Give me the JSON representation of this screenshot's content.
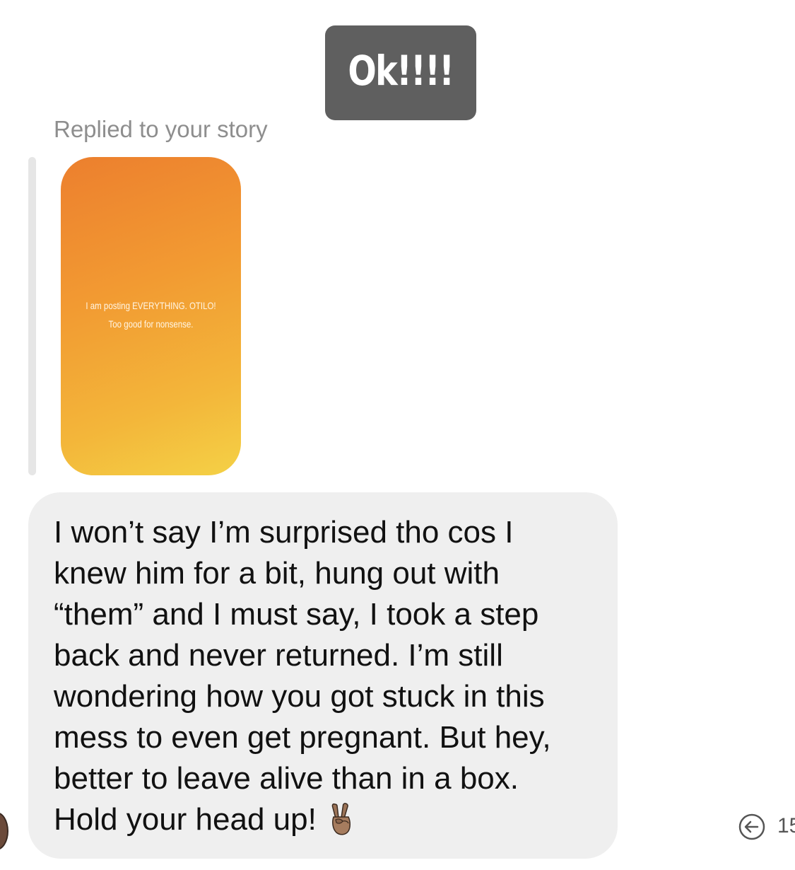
{
  "sticker": {
    "text": "Ok!!!!"
  },
  "reply": {
    "label": "Replied to your story"
  },
  "story": {
    "line1": "I am posting EVERYTHING. OTILO!",
    "line2": "Too good for nonsense."
  },
  "message": {
    "lines": [
      "I won’t say I’m surprised tho cos I",
      "knew him for a bit, hung out with",
      "“them” and I must say, I took a step",
      "back and never returned. I’m still",
      "wondering how you got stuck in this",
      "mess to even get pregnant. But hey,",
      "better to leave alive than in a box.",
      "Hold your head up!"
    ],
    "emoji": "victory-hand-medium-dark-skin-icon"
  },
  "meta": {
    "time_partial": "15"
  },
  "colors": {
    "sticker_bg": "#5f5f5f",
    "story_gradient_start": "#ec7f2e",
    "story_gradient_end": "#f4d146",
    "bubble_bg": "#efefef",
    "label_gray": "#8e8e8e"
  }
}
